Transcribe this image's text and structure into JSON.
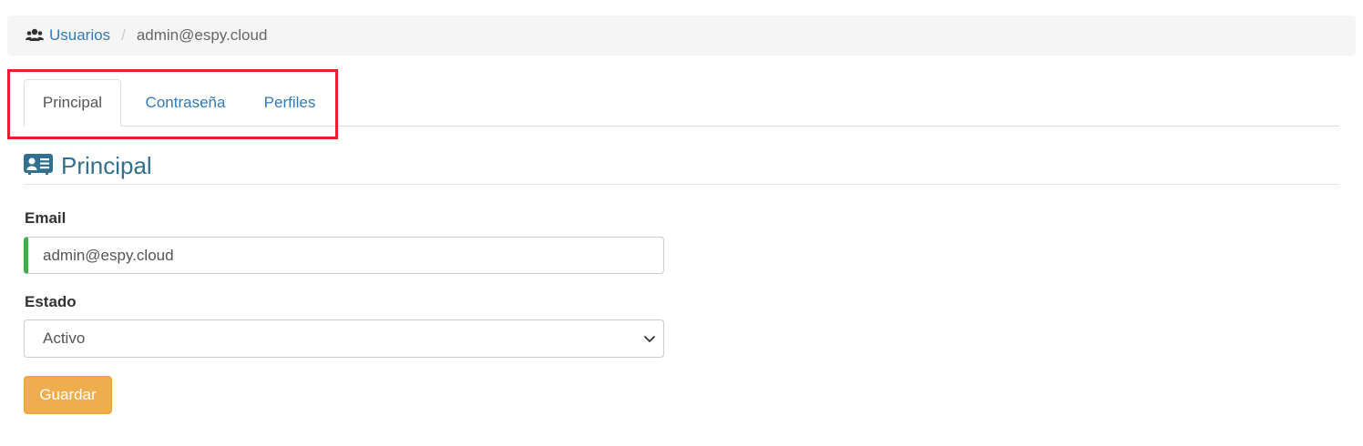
{
  "breadcrumb": {
    "icon": "users-icon",
    "parent_label": "Usuarios",
    "separator": "/",
    "current_label": "admin@espy.cloud"
  },
  "tabs": [
    {
      "label": "Principal",
      "active": true
    },
    {
      "label": "Contraseña",
      "active": false
    },
    {
      "label": "Perfiles",
      "active": false
    }
  ],
  "section": {
    "icon": "id-card-icon",
    "title": "Principal"
  },
  "form": {
    "email_label": "Email",
    "email_value": "admin@espy.cloud",
    "status_label": "Estado",
    "status_selected": "Activo",
    "save_label": "Guardar"
  },
  "colors": {
    "link": "#337ab7",
    "section_title": "#31708f",
    "button": "#f0ad4e",
    "valid_indicator": "#3fae49",
    "highlight_box": "#e3212d"
  }
}
